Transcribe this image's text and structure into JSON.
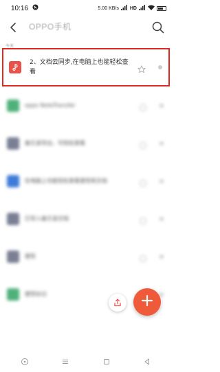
{
  "status_bar": {
    "time": "10:16",
    "net_speed": "5.00 KB/s",
    "signal_label": "HD",
    "battery": "battery-icon"
  },
  "app_bar": {
    "title": "OPPO手机",
    "back": "back-arrow-icon",
    "search": "search-icon"
  },
  "section": {
    "label": "今天"
  },
  "notes": [
    {
      "title": "2、文档云同步,在电脑上也能轻松查看",
      "icon_color": "#e8524a",
      "highlighted": true,
      "blurred": false
    },
    {
      "title": "oppo NoteTransfer",
      "icon_color": "#4fb07a",
      "highlighted": false,
      "blurred": true
    },
    {
      "title": "备忘录导出，可轻松查看",
      "icon_color": "#7a7f93",
      "highlighted": false,
      "blurred": true
    },
    {
      "title": "在电脑上也能轻松查看便签和文档",
      "icon_color": "#3d7bd9",
      "highlighted": false,
      "blurred": true
    },
    {
      "title": "已导入备忘录文档",
      "icon_color": "#7a7f93",
      "highlighted": false,
      "blurred": true
    },
    {
      "title": "便签",
      "icon_color": "#7a7f93",
      "highlighted": false,
      "blurred": true
    },
    {
      "title": "便签标记",
      "icon_color": "#4fb07a",
      "highlighted": false,
      "blurred": true
    }
  ],
  "colors": {
    "accent": "#ee5a3a",
    "highlight_border": "#e0281e"
  },
  "fab": {
    "main": "add-icon",
    "secondary": "share-icon"
  },
  "nav": {
    "items": [
      "home-icon",
      "menu-icon",
      "recent-square-icon",
      "back-triangle-icon"
    ]
  }
}
